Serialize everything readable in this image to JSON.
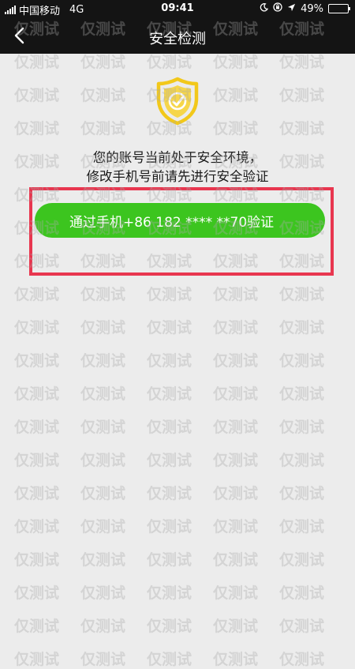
{
  "status_bar": {
    "carrier": "中国移动",
    "network": "4G",
    "time": "09:41",
    "battery": "49%",
    "battery_level": 0.49
  },
  "nav": {
    "title": "安全检测"
  },
  "message": {
    "line1": "您的账号当前处于安全环境，",
    "line2": "修改手机号前请先进行安全验证"
  },
  "verify_button": {
    "label": "通过手机+86 182 **** **70验证"
  },
  "watermark": "仅测试",
  "colors": {
    "bar_background": "#141414",
    "page_background": "#ececec",
    "button_green": "#3cc51f",
    "highlight_red": "#e8364f",
    "shield_yellow": "#f2c81a"
  },
  "icons": {
    "back": "chevron-left-icon",
    "shield": "shield-icon",
    "moon": "moon-icon",
    "lock_rotation": "lock-rotation-icon",
    "location": "location-arrow-icon",
    "battery": "battery-icon",
    "signal": "signal-icon"
  }
}
